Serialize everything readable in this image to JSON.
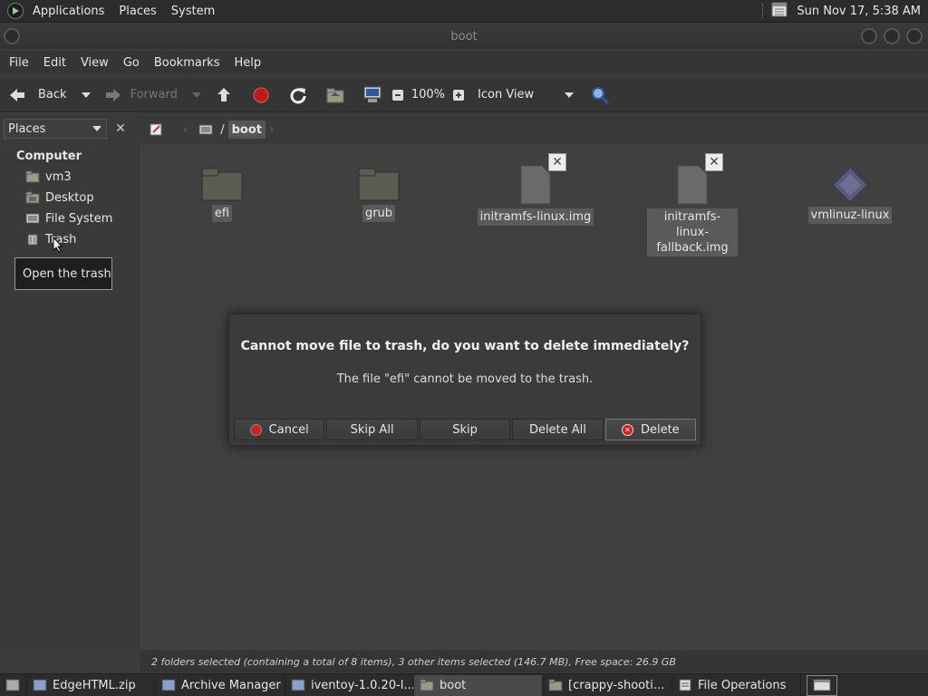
{
  "top_panel": {
    "menus": [
      "Applications",
      "Places",
      "System"
    ],
    "clock": "Sun Nov 17,  5:38 AM"
  },
  "window": {
    "title": "boot"
  },
  "menubar": [
    "File",
    "Edit",
    "View",
    "Go",
    "Bookmarks",
    "Help"
  ],
  "toolbar": {
    "back": "Back",
    "forward": "Forward",
    "zoom": "100%",
    "view_mode": "Icon View"
  },
  "sidepane": {
    "selector": "Places",
    "heading": "Computer",
    "items": [
      "vm3",
      "Desktop",
      "File System",
      "Trash"
    ],
    "tooltip": "Open the trash"
  },
  "location": {
    "separator": "/",
    "current": "boot"
  },
  "files": [
    {
      "name": "efi",
      "kind": "folder"
    },
    {
      "name": "grub",
      "kind": "folder"
    },
    {
      "name": "initramfs-linux.img",
      "kind": "file"
    },
    {
      "name": "initramfs-linux-fallback.img",
      "kind": "file"
    },
    {
      "name": "vmlinuz-linux",
      "kind": "kernel"
    }
  ],
  "dialog": {
    "title": "Cannot move file to trash, do you want to delete immediately?",
    "message": "The file \"efi\" cannot be moved to the trash.",
    "buttons": [
      "Cancel",
      "Skip All",
      "Skip",
      "Delete All",
      "Delete"
    ]
  },
  "statusbar": "2 folders selected (containing a total of 8 items), 3 other items selected (146.7 MB), Free space: 26.9 GB",
  "taskbar": [
    "EdgeHTML.zip",
    "Archive Manager",
    "iventoy-1.0.20-l...",
    "boot",
    "[crappy-shooti...",
    "File Operations"
  ],
  "colors": {
    "cancel_icon": "#d42020",
    "delete_icon": "#d42020"
  }
}
